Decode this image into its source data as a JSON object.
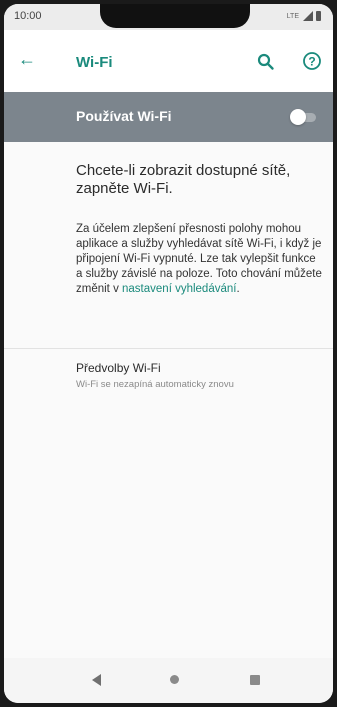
{
  "status_bar": {
    "time": "10:00",
    "network": "LTE"
  },
  "app_bar": {
    "back_icon": "arrow-left-icon",
    "title": "Wi-Fi",
    "search_icon": "search-icon",
    "help_icon": "help-icon"
  },
  "master_switch": {
    "label": "Používat Wi-Fi",
    "state": "off"
  },
  "empty_state": {
    "heading": "Chcete-li zobrazit dostupné sítě, zapněte Wi-Fi.",
    "info_text": "Za účelem zlepšení přesnosti polohy mohou aplikace a služby vyhledávat sítě Wi-Fi, i když je připojení Wi-Fi vypnuté. Lze tak vylepšit funkce a služby závislé na poloze. Toto chování můžete změnit v ",
    "info_link": "nastavení vyhledávání",
    "info_end": "."
  },
  "preferences": {
    "title": "Předvolby Wi-Fi",
    "subtitle": "Wi-Fi se nezapíná automaticky znovu"
  },
  "nav_bar": {
    "back": "nav-back-icon",
    "home": "nav-home-icon",
    "recents": "nav-recents-icon"
  },
  "colors": {
    "accent": "#1a8a7c",
    "master_bar": "#7c858d"
  }
}
